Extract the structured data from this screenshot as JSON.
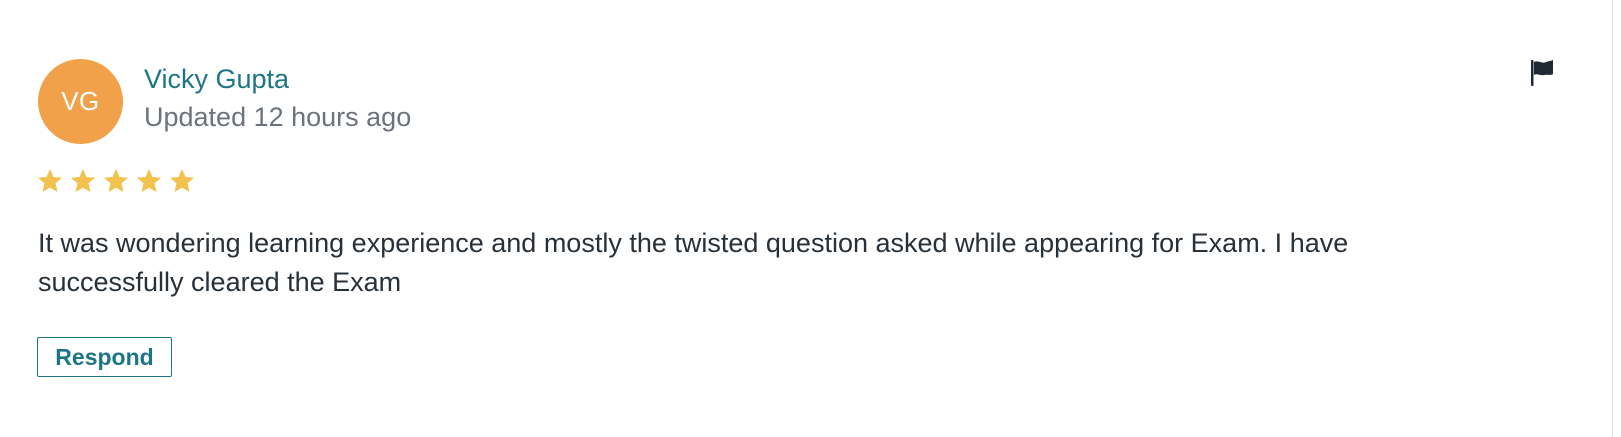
{
  "review": {
    "avatar_initials": "VG",
    "reviewer_name": "Vicky Gupta",
    "updated_text": "Updated 12 hours ago",
    "rating": 5,
    "rating_max": 5,
    "body": "It was wondering learning experience and mostly the twisted question asked while appearing for Exam. I have successfully cleared the Exam",
    "respond_label": "Respond",
    "flag_icon": "flag-icon",
    "star_icon": "star-icon"
  },
  "colors": {
    "avatar_background": "#f2a14b",
    "reviewer_name": "#1c7686",
    "muted_text": "#6b737d",
    "body_text": "#283038",
    "star_fill": "#f2c14e",
    "respond_accent": "#1c7686",
    "flag_fill": "#1f2933"
  }
}
